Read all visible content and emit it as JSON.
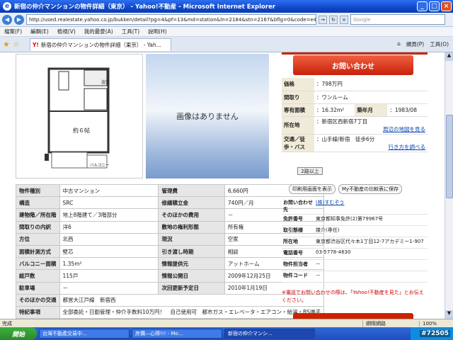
{
  "window": {
    "title": "新宿の仲介マンションの物件詳細（東京） - Yahoo!不動産 - Microsoft Internet Explorer"
  },
  "address": {
    "url": "http://used.realestate.yahoo.co.jp/bukken/detail?pg=4&pf=13&md=station&ln=2184&stn=2167&bflg=0&code=e436417970 1ebo",
    "search_placeholder": "Google"
  },
  "menu": [
    "檔案(F)",
    "編輯(E)",
    "檢視(V)",
    "我的最愛(A)",
    "工具(T)",
    "說明(H)"
  ],
  "tab": {
    "label": "新宿の仲介マンションの物件詳細（東京） - Yah..."
  },
  "tools": [
    "網頁(P)",
    "工具(O)"
  ],
  "listing": {
    "no_image": "画像はありません",
    "floorplan_room": "約６帖",
    "floorplan_bath": "浴室",
    "floorplan_balcony": "バルコニー",
    "specs": [
      [
        "物件種別",
        "中古マンション",
        "管理費",
        "6,660円"
      ],
      [
        "構造",
        "SRC",
        "修繕積立金",
        "740円／月"
      ],
      [
        "建物階／所在階",
        "地上8階建て／3階部分",
        "そのほかの費用",
        "－"
      ],
      [
        "間取りの内訳",
        "洋6",
        "敷地の権利形態",
        "所有権"
      ],
      [
        "方位",
        "北西",
        "現況",
        "空家"
      ],
      [
        "面積計測方式",
        "壁芯",
        "引き渡し時期",
        "相談"
      ],
      [
        "バルコニー面積",
        "1.35m²",
        "情報提供元",
        "アットホーム"
      ],
      [
        "総戸数",
        "115戸",
        "情報公開日",
        "2009年12月25日"
      ],
      [
        "駐車場",
        "－",
        "次回更新予定日",
        "2010年1月19日"
      ],
      [
        "そのほかの交通",
        "都営大江戸線　新宿西",
        "",
        ""
      ],
      [
        "特記事項",
        "全部委託・日勤管理・仲介手数料10万円！　自己使用可　都市ガス・エレベータ・エアコン・給湯・BS端子",
        "",
        ""
      ]
    ]
  },
  "side": {
    "cta": "お問い合わせ",
    "price_k": "価格",
    "price_v": "：798万円",
    "layout_k": "間取り",
    "layout_v": "：ワンルーム",
    "area_k": "専有面積",
    "area_v": "：16.32m²",
    "built_k": "築年月",
    "built_v": "：1983/08",
    "addr_k": "所在地",
    "addr_v": "：新宿区西新宿7丁目",
    "map_link": "周辺の地図を見る",
    "transit_k": "交通／徒歩・バス",
    "transit_v": "：山手線/新宿　徒歩6分",
    "route_link": "行き方を調べる",
    "walk_btn": "2路以上",
    "print_btn": "印刷用画面を表示",
    "compare_btn": "My不動産の比較表に保存"
  },
  "agent": {
    "rows": [
      [
        "お問い合わせ先",
        "(株)すむぞう"
      ],
      [
        "免許番号",
        "東京都知事免許(2)第79967号"
      ],
      [
        "取引態様",
        "媒介(専任)"
      ],
      [
        "所在地",
        "東京都渋谷区代々木1丁目12-7アカデミー1-907"
      ],
      [
        "電話番号",
        "03-5778-4630"
      ],
      [
        "物件担当者",
        "－"
      ],
      [
        "物件コード",
        "－"
      ]
    ],
    "notice": "※電話でお問い合わせの際は、「Yahoo!不動産を見た」とお伝えください。"
  },
  "status": {
    "text": "完成",
    "zone": "網際網路",
    "zoom": "100%"
  },
  "taskbar": {
    "start": "開始",
    "tasks": [
      "台灣不動產交易中...",
      "房價—心得!!! - Mo...",
      "新宿の仲介マンシ..."
    ],
    "watermark": "#72505"
  }
}
